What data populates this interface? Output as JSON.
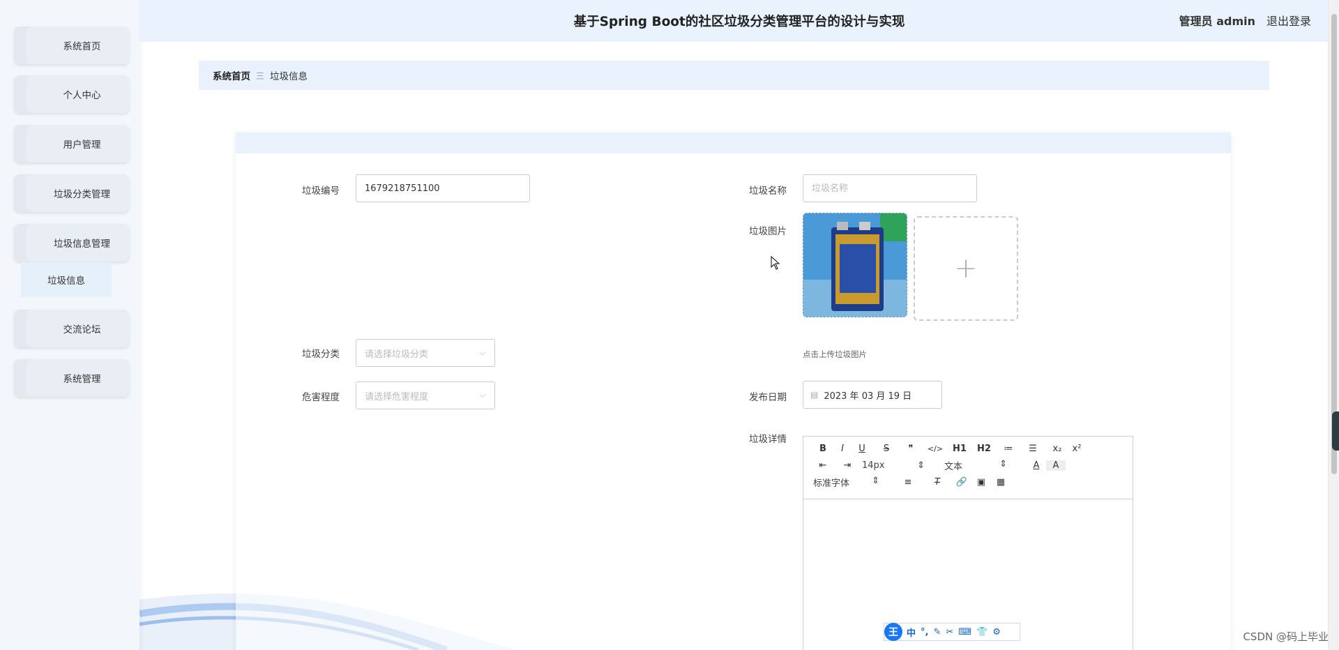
{
  "header": {
    "title": "基于Spring Boot的社区垃圾分类管理平台的设计与实现",
    "user": "管理员 admin",
    "logout": "退出登录"
  },
  "sidebar": {
    "items": [
      {
        "label": "系统首页"
      },
      {
        "label": "个人中心"
      },
      {
        "label": "用户管理"
      },
      {
        "label": "垃圾分类管理"
      },
      {
        "label": "垃圾信息管理"
      },
      {
        "label": "交流论坛"
      },
      {
        "label": "系统管理"
      }
    ],
    "submenu": {
      "label": "垃圾信息"
    }
  },
  "breadcrumb": {
    "home": "系统首页",
    "separator": "三",
    "current": "垃圾信息"
  },
  "form": {
    "code_label": "垃圾编号",
    "code_value": "1679218751100",
    "name_label": "垃圾名称",
    "name_placeholder": "垃圾名称",
    "image_label": "垃圾图片",
    "upload_plus": "+",
    "upload_hint": "点击上传垃圾图片",
    "category_label": "垃圾分类",
    "category_placeholder": "请选择垃圾分类",
    "hazard_label": "危害程度",
    "hazard_placeholder": "请选择危害程度",
    "date_label": "发布日期",
    "date_value": "2023 年 03 月 19 日",
    "detail_label": "垃圾详情"
  },
  "editor": {
    "row1": [
      "B",
      "I",
      "U",
      "S",
      "❞",
      "</>",
      "H1",
      "H2",
      "≔",
      "☰",
      "x₂",
      "x²"
    ],
    "font_size": "14px",
    "text_type": "文本",
    "font_family": "标准字体"
  },
  "ime": {
    "logo": "王",
    "items": [
      "中",
      "°,",
      "✎",
      "✂",
      "⌨",
      "👕",
      "⚙"
    ]
  },
  "watermark": "CSDN @码上毕业",
  "colors": {
    "accent": "#1877f2",
    "header_bg": "#eaf3fd",
    "sidebar_bg": "#f3f6fb"
  }
}
